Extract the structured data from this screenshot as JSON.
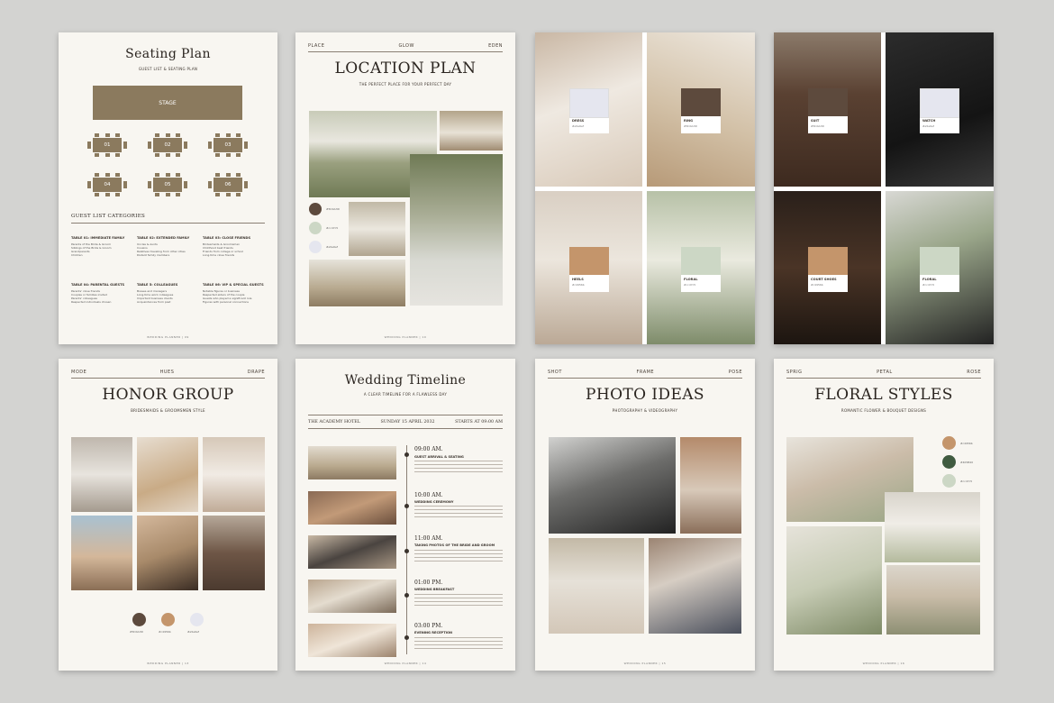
{
  "colors": {
    "background": "#d3d3d1",
    "paper": "#f8f6f1",
    "accent": "#8b7a5e",
    "dark_brown": "#5d4a3d",
    "tan": "#c4956b",
    "sage": "#ccd7c5",
    "lavender": "#e5e6ef"
  },
  "seating": {
    "title": "Seating Plan",
    "subtitle": "GUEST LIST & SEATING PLAN",
    "stage": "STAGE",
    "tables": [
      "01",
      "02",
      "03",
      "04",
      "05",
      "06"
    ],
    "categories_title": "GUEST LIST CATEGORIES",
    "columns": [
      {
        "title": "TABLE 01: IMMEDIATE FAMILY",
        "items": [
          "Parents of the Bride & Groom",
          "Siblings of the Bride & Groom",
          "Grandparents",
          "Children"
        ]
      },
      {
        "title": "TABLE 02: EXTENDED FAMILY",
        "items": [
          "Uncles & Aunts",
          "Cousins",
          "Relatives traveling from other cities",
          "Distant family members"
        ]
      },
      {
        "title": "TABLE 03: CLOSE FRIENDS",
        "items": [
          "Bridesmaids & Groomsmen",
          "Childhood best friends",
          "Friends from college or school",
          "Long-time close friends"
        ]
      },
      {
        "title": "TABLE 04: PARENTAL GUESTS",
        "items": [
          "Parents' close friends",
          "Couples or families invited",
          "Parents' colleagues",
          "Respected individuals chosen"
        ]
      },
      {
        "title": "TABLE 5: COLLEAGUES",
        "items": [
          "Bosses and managers",
          "Long-time work colleagues",
          "Important business clients",
          "Acquaintances from past"
        ]
      },
      {
        "title": "TABLE 06: VIP & SPECIAL GUESTS",
        "items": [
          "Notable figures or business",
          "Respected elders of the couple",
          "Guests who played a significant role",
          "Figures with personal connections"
        ]
      }
    ],
    "footer": "WEDDING PLANNER | 09"
  },
  "location": {
    "header": [
      "PLACE",
      "GLOW",
      "EDEN"
    ],
    "title": "LOCATION PLAN",
    "subtitle": "THE PERFECT PLACE FOR YOUR PERFECT DAY",
    "swatches": [
      {
        "hex": "#5D4A3D",
        "label": "#5D4A3D"
      },
      {
        "hex": "#CCD7C5",
        "label": "#ccd7c5"
      },
      {
        "hex": "#E5E6EF",
        "label": "#e5e6ef"
      }
    ],
    "footer": "WEDDING PLANNER | 10"
  },
  "bride_board": {
    "chips": [
      {
        "label": "DRESS",
        "hex": "#e5e6ef",
        "color": "#e5e6ef"
      },
      {
        "label": "RING",
        "hex": "#5D4A3D",
        "color": "#5d4a3d"
      },
      {
        "label": "HEELS",
        "hex": "#c4956b",
        "color": "#c4956b"
      },
      {
        "label": "FLORAL",
        "hex": "#ccd7c5",
        "color": "#ccd7c5"
      }
    ]
  },
  "groom_board": {
    "chips": [
      {
        "label": "SUIT",
        "hex": "#5D4A3D",
        "color": "#5d4a3d"
      },
      {
        "label": "WATCH",
        "hex": "#e5e6ef",
        "color": "#e5e6ef"
      },
      {
        "label": "COURT SHOES",
        "hex": "#c4956b",
        "color": "#c4956b"
      },
      {
        "label": "FLORAL",
        "hex": "#ccd7c5",
        "color": "#ccd7c5"
      }
    ]
  },
  "honor": {
    "header": [
      "MODE",
      "HUES",
      "DRAPE"
    ],
    "title": "HONOR GROUP",
    "subtitle": "BRIDESMAIDS & GROOMSMEN STYLE",
    "swatches": [
      {
        "hex": "#5D4A3D",
        "label": "#5D4A3D"
      },
      {
        "hex": "#c4956b",
        "label": "#c4956b"
      },
      {
        "hex": "#e5e6ef",
        "label": "#e5e6ef"
      }
    ],
    "footer": "WEDDING PLANNER | 13"
  },
  "timeline": {
    "title": "Wedding Timeline",
    "subtitle": "A CLEAR TIMELINE FOR A FLAWLESS DAY",
    "info": [
      "THE ACADEMY HOTEL",
      "SUNDAY 15 APRIL 2032",
      "STARTS AT 09:00 AM"
    ],
    "events": [
      {
        "time": "09:00 AM.",
        "title": "GUEST ARRIVAL & SEATING"
      },
      {
        "time": "10:00 AM.",
        "title": "WEDDING CEREMONY"
      },
      {
        "time": "11:00 AM.",
        "title": "TAKING PHOTOS OF THE BRIDE AND GROOM"
      },
      {
        "time": "01:00 PM.",
        "title": "WEDDING BREAKFAST"
      },
      {
        "time": "03:00 PM.",
        "title": "EVENING RECEPTION"
      }
    ],
    "footer": "WEDDING PLANNER | 14"
  },
  "photo_ideas": {
    "header": [
      "SHOT",
      "FRAME",
      "POSE"
    ],
    "title": "PHOTO IDEAS",
    "subtitle": "PHOTOGRAPHY & VIDEOGRAPHY",
    "footer": "WEDDING PLANNER | 15"
  },
  "floral": {
    "header": [
      "SPRIG",
      "PETAL",
      "ROSE"
    ],
    "title": "FLORAL STYLES",
    "subtitle": "ROMANTIC FLOWER & BOUQUET DESIGNS",
    "swatches": [
      {
        "hex": "#c4956b",
        "label": "#c4956b"
      },
      {
        "hex": "#405B40",
        "label": "#405B40"
      },
      {
        "hex": "#ccd7c5",
        "label": "#ccd7c5"
      }
    ],
    "footer": "WEDDING PLANNER | 16"
  }
}
